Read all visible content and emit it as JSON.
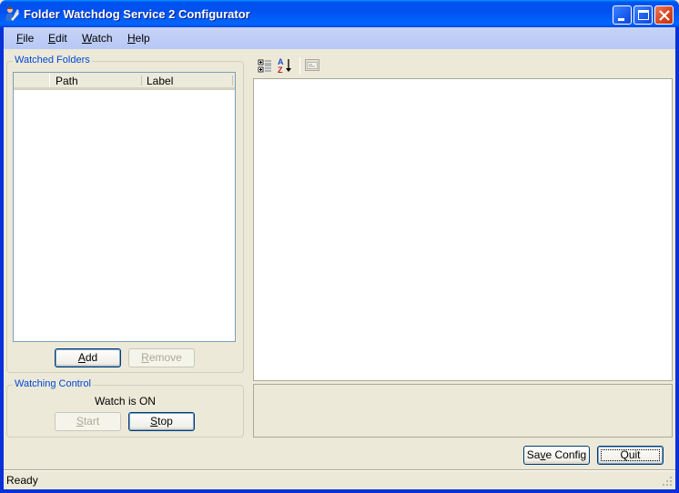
{
  "window": {
    "title": "Folder Watchdog Service 2 Configurator",
    "app_icon": "user-writing-icon",
    "controls": [
      "minimize",
      "maximize",
      "close"
    ]
  },
  "menubar": {
    "items": [
      {
        "label": "File",
        "mnemonic": "F",
        "rest": "ile"
      },
      {
        "label": "Edit",
        "mnemonic": "E",
        "rest": "dit"
      },
      {
        "label": "Watch",
        "mnemonic": "W",
        "rest": "atch"
      },
      {
        "label": "Help",
        "mnemonic": "H",
        "rest": "elp"
      }
    ]
  },
  "watched_folders": {
    "group_label": "Watched Folders",
    "columns": [
      "",
      "Path",
      "Label"
    ],
    "rows": [],
    "add_button": {
      "label": "Add",
      "mnemonic": "A",
      "rest": "dd",
      "enabled": true
    },
    "remove_button": {
      "label": "Remove",
      "mnemonic": "R",
      "rest": "emove",
      "enabled": false
    }
  },
  "watching_control": {
    "group_label": "Watching Control",
    "status": "Watch is ON",
    "start_button": {
      "label": "Start",
      "mnemonic": "S",
      "rest": "tart",
      "enabled": false
    },
    "stop_button": {
      "label": "Stop",
      "mnemonic": "S",
      "rest": "top",
      "enabled": true
    }
  },
  "property_grid": {
    "toolbar": [
      "categorized-icon",
      "alphabetical-sort-icon",
      "property-pages-icon"
    ],
    "properties": [],
    "description": ""
  },
  "footer": {
    "save_button": {
      "label": "Save Config",
      "pre": "Sa",
      "mnemonic": "v",
      "rest": "e Config"
    },
    "quit_button": {
      "label": "Quit"
    }
  },
  "statusbar": {
    "text": "Ready"
  }
}
